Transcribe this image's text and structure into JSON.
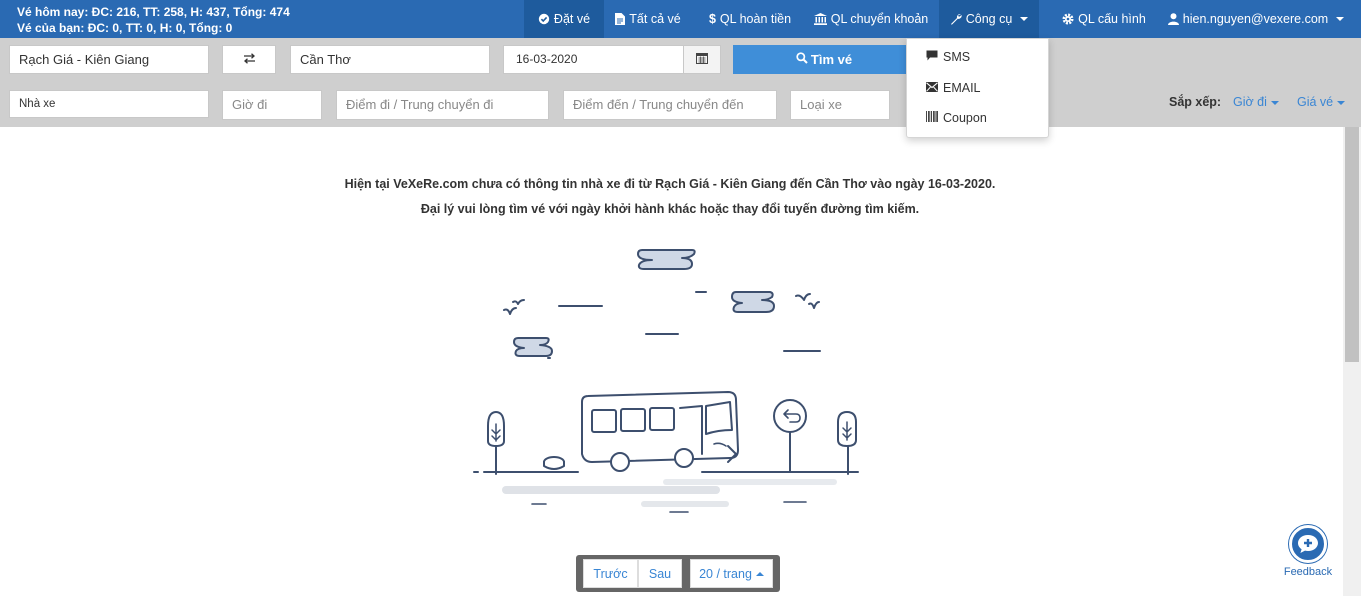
{
  "header": {
    "stats_today": "Vé hôm nay: ĐC: 216, TT: 258, H: 437, Tổng: 474",
    "stats_yours": "Vé của bạn: ĐC: 0, TT: 0, H: 0, Tổng: 0",
    "nav": {
      "book": "Đặt vé",
      "all_tickets": "Tất cả vé",
      "refunds": "QL hoàn tiền",
      "transfers": "QL chuyển khoản",
      "tools": "Công cụ",
      "config": "QL cấu hình",
      "user": "hien.nguyen@vexere.com"
    }
  },
  "tools_menu": {
    "items": [
      "SMS",
      "EMAIL",
      "Coupon"
    ]
  },
  "search": {
    "from": "Rạch Giá - Kiên Giang",
    "to": "Cần Thơ",
    "date": "16-03-2020",
    "search_button": "Tìm vé"
  },
  "filters": {
    "operator": "Nhà xe",
    "departure_time": "Giờ đi",
    "pickup": "Điểm đi / Trung chuyển đi",
    "dropoff": "Điểm đến / Trung chuyển đến",
    "vehicle_type": "Loại xe",
    "sort_label": "Sắp xếp:",
    "sort_time": "Giờ đi",
    "sort_price": "Giá vé"
  },
  "main": {
    "message_line1": "Hiện tại VeXeRe.com chưa có thông tin nhà xe đi từ Rạch Giá - Kiên Giang đến Cần Thơ vào ngày 16-03-2020.",
    "message_line2": "Đại lý vui lòng tìm vé với ngày khởi hành khác hoặc thay đổi tuyến đường tìm kiếm."
  },
  "pagination": {
    "prev": "Trước",
    "next": "Sau",
    "page_size": "20 / trang"
  },
  "feedback": {
    "label": "Feedback"
  },
  "colors": {
    "navbar": "#2a6ab3",
    "nav_active": "#1e5b9d",
    "search_button": "#3f8ed8",
    "link": "#3a86d4",
    "illustration": "#3d4f6e"
  },
  "icons": [
    "check-circle-icon",
    "document-icon",
    "dollar-icon",
    "bank-icon",
    "wrench-icon",
    "gear-icon",
    "user-icon",
    "swap-icon",
    "calendar-icon",
    "search-icon",
    "chat-icon",
    "envelope-icon",
    "barcode-icon",
    "feedback-icon"
  ]
}
